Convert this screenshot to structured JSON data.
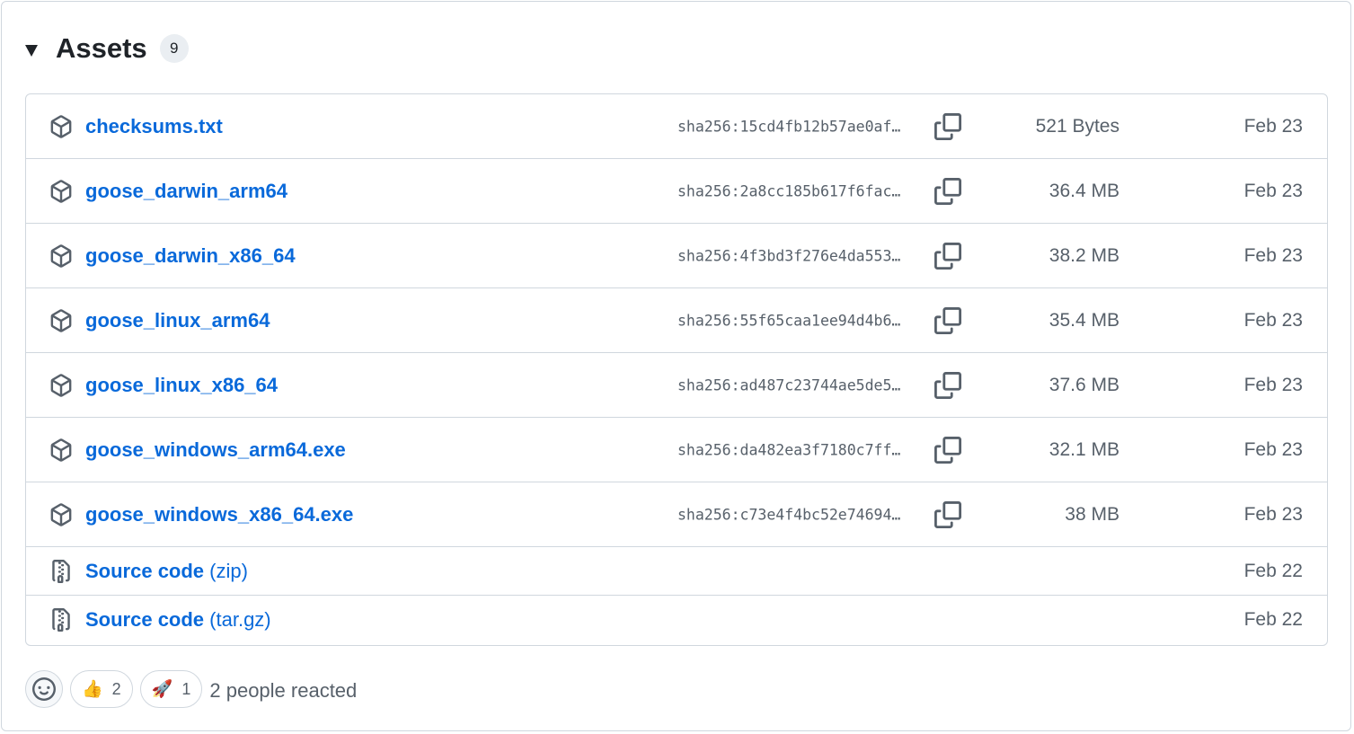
{
  "assets": {
    "title": "Assets",
    "count": "9",
    "items": [
      {
        "name": "checksums.txt",
        "sha": "sha256:15cd4fb12b57ae0af…",
        "size": "521 Bytes",
        "date": "Feb 23",
        "icon": "package-icon"
      },
      {
        "name": "goose_darwin_arm64",
        "sha": "sha256:2a8cc185b617f6fac…",
        "size": "36.4 MB",
        "date": "Feb 23",
        "icon": "package-icon"
      },
      {
        "name": "goose_darwin_x86_64",
        "sha": "sha256:4f3bd3f276e4da553…",
        "size": "38.2 MB",
        "date": "Feb 23",
        "icon": "package-icon"
      },
      {
        "name": "goose_linux_arm64",
        "sha": "sha256:55f65caa1ee94d4b6…",
        "size": "35.4 MB",
        "date": "Feb 23",
        "icon": "package-icon"
      },
      {
        "name": "goose_linux_x86_64",
        "sha": "sha256:ad487c23744ae5de5…",
        "size": "37.6 MB",
        "date": "Feb 23",
        "icon": "package-icon"
      },
      {
        "name": "goose_windows_arm64.exe",
        "sha": "sha256:da482ea3f7180c7ff…",
        "size": "32.1 MB",
        "date": "Feb 23",
        "icon": "package-icon"
      },
      {
        "name": "goose_windows_x86_64.exe",
        "sha": "sha256:c73e4f4bc52e74694…",
        "size": "38 MB",
        "date": "Feb 23",
        "icon": "package-icon"
      }
    ],
    "source": [
      {
        "name": "Source code",
        "ext": "(zip)",
        "date": "Feb 22",
        "icon": "file-zip-icon"
      },
      {
        "name": "Source code",
        "ext": "(tar.gz)",
        "date": "Feb 22",
        "icon": "file-zip-icon"
      }
    ]
  },
  "reactions": {
    "items": [
      {
        "emoji": "👍",
        "icon": "thumbs-up-icon",
        "count": "2"
      },
      {
        "emoji": "🚀",
        "icon": "rocket-icon",
        "count": "1"
      }
    ],
    "summary": "2 people reacted"
  },
  "colors": {
    "link": "#0969da",
    "muted": "#57606a",
    "border": "#d0d7de",
    "counter_bg": "#eaeef2"
  }
}
